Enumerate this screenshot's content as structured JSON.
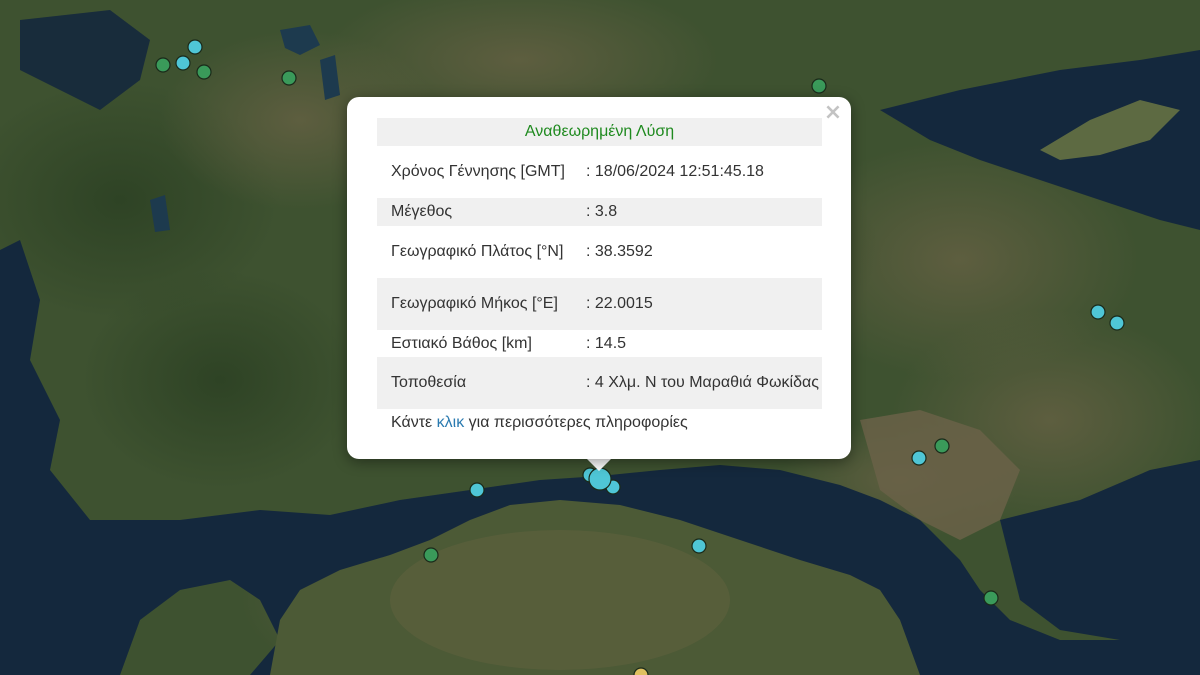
{
  "popup": {
    "title": "Αναθεωρημένη Λύση",
    "rows": [
      {
        "label": "Χρόνος Γέννησης [GMT]",
        "value": ": 18/06/2024 12:51:45.18"
      },
      {
        "label": "Μέγεθος",
        "value": ": 3.8"
      },
      {
        "label": "Γεωγραφικό Πλάτος [°N]",
        "value": ": 38.3592"
      },
      {
        "label": "Γεωγραφικό Μήκος [°E]",
        "value": ": 22.0015"
      },
      {
        "label": "Εστιακό Βάθος [km]",
        "value": ": 14.5"
      },
      {
        "label": "Τοποθεσία",
        "value": ": 4 Χλμ. Ν του Μαραθιά Φωκίδας"
      }
    ],
    "footer_prefix": "Κάντε",
    "footer_link": "κλικ",
    "footer_suffix": "για περισσότερες πληροφορίες",
    "close_symbol": "×"
  },
  "colors": {
    "land_dark": "#33482a",
    "land_mid": "#4d5a35",
    "land_brown": "#6b5f45",
    "sea": "#14283d",
    "marker_cyan": "#4fc6d6",
    "marker_green": "#3a9a5a",
    "marker_yellow": "#e0c060",
    "title_green": "#1f8a1f",
    "link_blue": "#2a7ab0"
  }
}
